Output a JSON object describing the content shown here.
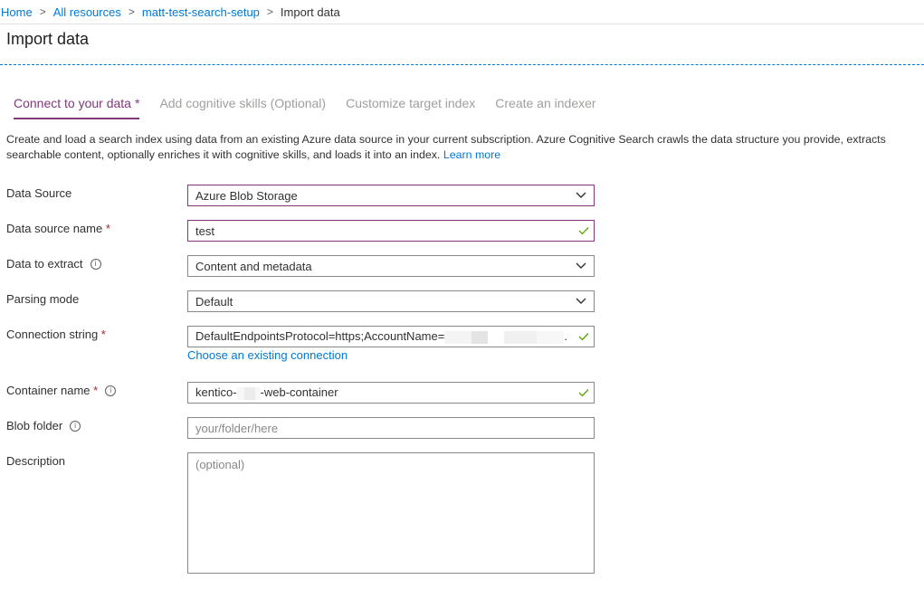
{
  "breadcrumb": {
    "items": [
      "Home",
      "All resources",
      "matt-test-search-setup"
    ],
    "current": "Import data",
    "separator": ">"
  },
  "page": {
    "title": "Import data"
  },
  "tabs": [
    {
      "label": "Connect to your data",
      "required_mark": "*",
      "active": true
    },
    {
      "label": "Add cognitive skills (Optional)",
      "active": false
    },
    {
      "label": "Customize target index",
      "active": false
    },
    {
      "label": "Create an indexer",
      "active": false
    }
  ],
  "intro": {
    "text": "Create and load a search index using data from an existing Azure data source in your current subscription. Azure Cognitive Search crawls the data structure you provide, extracts searchable content, optionally enriches it with cognitive skills, and loads it into an index.",
    "learn_more": "Learn more"
  },
  "form": {
    "required_mark": "*",
    "data_source": {
      "label": "Data Source",
      "value": "Azure Blob Storage"
    },
    "data_source_name": {
      "label": "Data source name",
      "value": "test"
    },
    "data_to_extract": {
      "label": "Data to extract",
      "value": "Content and metadata"
    },
    "parsing_mode": {
      "label": "Parsing mode",
      "value": "Default"
    },
    "connection_string": {
      "label": "Connection string",
      "value_prefix": "DefaultEndpointsProtocol=https;AccountName=",
      "value_suffix": ".",
      "link": "Choose an existing connection"
    },
    "container_name": {
      "label": "Container name",
      "value_prefix": "kentico-",
      "value_suffix": "-web-container"
    },
    "blob_folder": {
      "label": "Blob folder",
      "placeholder": "your/folder/here"
    },
    "description": {
      "label": "Description",
      "placeholder": "(optional)"
    }
  },
  "icons": {
    "info": "info-icon",
    "dropdown": "chevron-down-icon",
    "valid": "checkmark-icon",
    "breadcrumb_sep": "chevron-right-icon"
  },
  "colors": {
    "link": "#0078d4",
    "accent": "#80397b",
    "required": "#a4262c",
    "valid": "#57a300"
  }
}
